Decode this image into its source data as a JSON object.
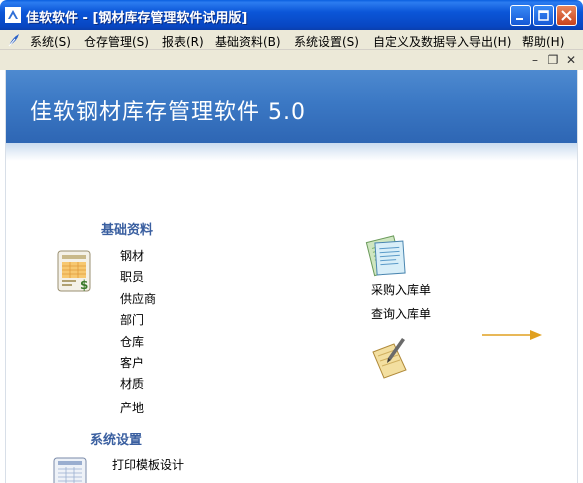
{
  "window": {
    "title": "佳软软件 - [钢材库存管理软件试用版]"
  },
  "menu": [
    "系统(S)",
    "仓存管理(S)",
    "报表(R)",
    "基础资料(B)",
    "系统设置(S)",
    "自定义及数据导入导出(H)",
    "帮助(H)"
  ],
  "banner": {
    "title": "佳软钢材库存管理软件 5.0"
  },
  "basic": {
    "title": "基础资料",
    "items": [
      "钢材",
      "职员",
      "供应商",
      "部门",
      "仓库",
      "客户",
      "材质",
      "产地"
    ]
  },
  "settings": {
    "title": "系统设置",
    "items": [
      "打印模板设计"
    ]
  },
  "purchase": {
    "items": [
      "采购入库单",
      "查询入库单"
    ]
  },
  "icons": {
    "app": "app-icon",
    "basic": "invoice-icon",
    "settings": "template-icon",
    "purchase": "documents-icon",
    "notepad": "notepad-icon",
    "arrow": "arrow-right-icon"
  }
}
